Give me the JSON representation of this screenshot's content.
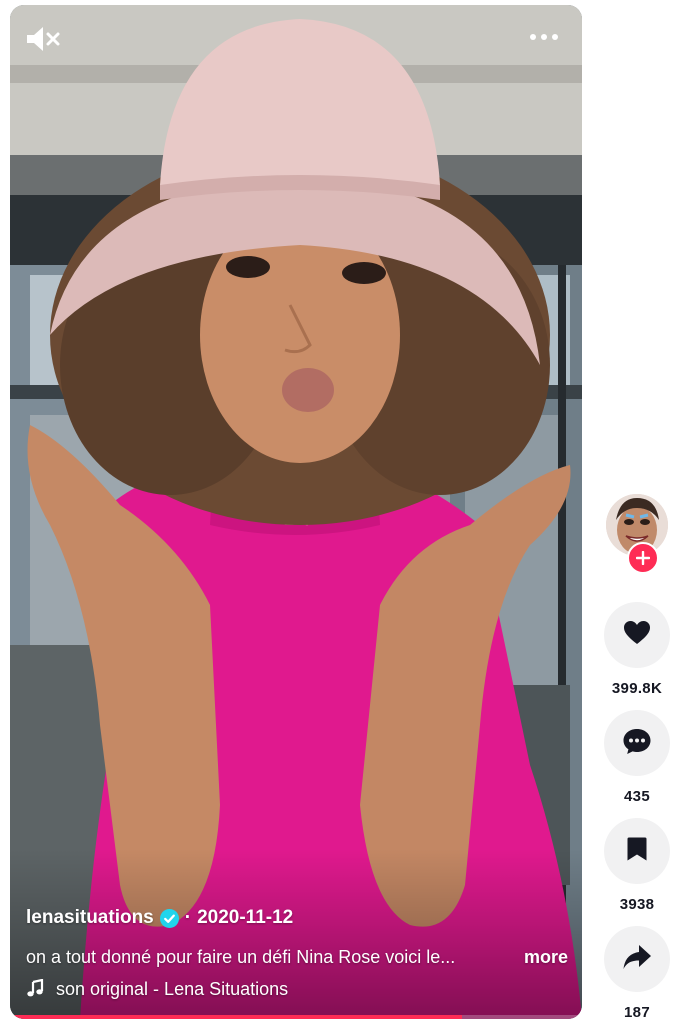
{
  "video": {
    "author": "lenasituations",
    "separator": "·",
    "date": "2020-11-12",
    "description": "on a tout donné pour faire un défi Nina Rose voici le...",
    "more_label": "more",
    "music": "son original - Lena Situations",
    "progress": 0.79
  },
  "icons": {
    "mute": "speaker-muted-icon",
    "menu": "more-horizontal-icon",
    "verified": "verified-badge-icon",
    "music": "music-note-icon",
    "like": "heart-icon",
    "comment": "comment-bubble-icon",
    "save": "bookmark-icon",
    "share": "share-arrow-icon",
    "follow": "plus-icon"
  },
  "actions": {
    "likes": "399.8K",
    "comments": "435",
    "saves": "3938",
    "shares": "187"
  },
  "colors": {
    "accent": "#fe2c55",
    "verified": "#20d5ec",
    "rail_button": "#f1f1f2",
    "count_text": "#161823",
    "top": "#e0198e",
    "hat": "#e8c9c7"
  }
}
